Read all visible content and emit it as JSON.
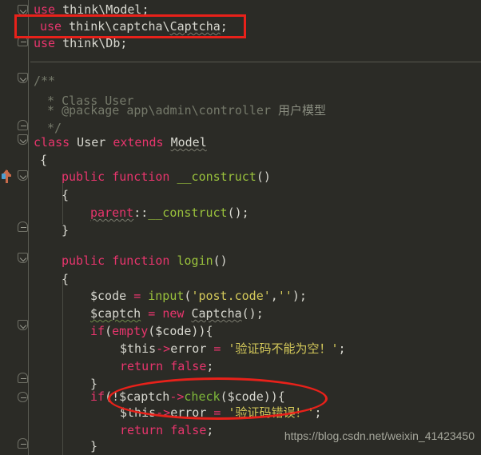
{
  "editor": {
    "language": "PHP",
    "background_color": "#2b2b26",
    "foreground_color": "#d8d8d0",
    "keyword_color": "#e8356d",
    "function_color": "#9ac23c",
    "string_color": "#d4c95a",
    "comment_color": "#767a6b",
    "annotation_color": "#e8211a"
  },
  "lines": [
    {
      "id": "l1",
      "indent": 0,
      "tokens": [
        {
          "t": "use",
          "c": "kw"
        },
        {
          "t": " think\\Model;",
          "c": "id"
        }
      ]
    },
    {
      "id": "l2",
      "indent": 0,
      "tokens": [
        {
          "t": "use",
          "c": "kw"
        },
        {
          "t": " think\\captcha\\Captcha;",
          "c": "id"
        }
      ]
    },
    {
      "id": "l3",
      "indent": 0,
      "tokens": [
        {
          "t": "use",
          "c": "kw"
        },
        {
          "t": " think\\Db;",
          "c": "id"
        }
      ]
    },
    {
      "id": "l4",
      "indent": 0,
      "tokens": [
        {
          "t": "/**",
          "c": "cmt"
        }
      ]
    },
    {
      "id": "l5",
      "indent": 0,
      "tokens": [
        {
          "t": " * Class User",
          "c": "cmt"
        }
      ]
    },
    {
      "id": "l6",
      "indent": 0,
      "tokens": [
        {
          "t": " * @package app\\admin\\controller 用户模型",
          "c": "cmt"
        }
      ]
    },
    {
      "id": "l7",
      "indent": 0,
      "tokens": [
        {
          "t": " */",
          "c": "cmt"
        }
      ]
    },
    {
      "id": "l8",
      "indent": 0,
      "tokens": [
        {
          "t": "class",
          "c": "kw"
        },
        {
          "t": " User ",
          "c": "id"
        },
        {
          "t": "extends",
          "c": "kw"
        },
        {
          "t": " Model",
          "c": "id"
        }
      ]
    },
    {
      "id": "l9",
      "indent": 0,
      "tokens": [
        {
          "t": "{",
          "c": "punc"
        }
      ]
    },
    {
      "id": "l10",
      "indent": 1,
      "tokens": [
        {
          "t": "public function",
          "c": "kw"
        },
        {
          "t": " ",
          "c": "id"
        },
        {
          "t": "__construct",
          "c": "fn"
        },
        {
          "t": "()",
          "c": "punc"
        }
      ]
    },
    {
      "id": "l11",
      "indent": 1,
      "tokens": [
        {
          "t": "{",
          "c": "punc"
        }
      ]
    },
    {
      "id": "l12",
      "indent": 2,
      "tokens": [
        {
          "t": "parent",
          "c": "kw"
        },
        {
          "t": "::",
          "c": "punc"
        },
        {
          "t": "__construct",
          "c": "fn"
        },
        {
          "t": "();",
          "c": "punc"
        }
      ]
    },
    {
      "id": "l13",
      "indent": 1,
      "tokens": [
        {
          "t": "}",
          "c": "punc"
        }
      ]
    },
    {
      "id": "l14",
      "indent": 0,
      "tokens": []
    },
    {
      "id": "l15",
      "indent": 1,
      "tokens": [
        {
          "t": "public function",
          "c": "kw"
        },
        {
          "t": " ",
          "c": "id"
        },
        {
          "t": "login",
          "c": "fn"
        },
        {
          "t": "()",
          "c": "punc"
        }
      ]
    },
    {
      "id": "l16",
      "indent": 1,
      "tokens": [
        {
          "t": "{",
          "c": "punc"
        }
      ]
    },
    {
      "id": "l17",
      "indent": 2,
      "tokens": [
        {
          "t": "$code ",
          "c": "id"
        },
        {
          "t": "=",
          "c": "kw"
        },
        {
          "t": " ",
          "c": "id"
        },
        {
          "t": "input",
          "c": "fn"
        },
        {
          "t": "(",
          "c": "punc"
        },
        {
          "t": "'post.code'",
          "c": "str"
        },
        {
          "t": ",",
          "c": "punc"
        },
        {
          "t": "''",
          "c": "str"
        },
        {
          "t": ");",
          "c": "punc"
        }
      ]
    },
    {
      "id": "l18",
      "indent": 2,
      "tokens": [
        {
          "t": "$captch ",
          "c": "id"
        },
        {
          "t": "=",
          "c": "kw"
        },
        {
          "t": " ",
          "c": "id"
        },
        {
          "t": "new",
          "c": "kw"
        },
        {
          "t": " Captcha();",
          "c": "id"
        }
      ]
    },
    {
      "id": "l19",
      "indent": 2,
      "tokens": [
        {
          "t": "if",
          "c": "kw"
        },
        {
          "t": "(",
          "c": "punc"
        },
        {
          "t": "empty",
          "c": "kw"
        },
        {
          "t": "($code)){",
          "c": "punc"
        }
      ]
    },
    {
      "id": "l20",
      "indent": 3,
      "tokens": [
        {
          "t": "$this",
          "c": "id"
        },
        {
          "t": "->",
          "c": "kw"
        },
        {
          "t": "error ",
          "c": "id"
        },
        {
          "t": "=",
          "c": "kw"
        },
        {
          "t": " ",
          "c": "id"
        },
        {
          "t": "'验证码不能为空！'",
          "c": "str"
        },
        {
          "t": ";",
          "c": "punc"
        }
      ]
    },
    {
      "id": "l21",
      "indent": 3,
      "tokens": [
        {
          "t": "return false",
          "c": "kw"
        },
        {
          "t": ";",
          "c": "punc"
        }
      ]
    },
    {
      "id": "l22",
      "indent": 2,
      "tokens": [
        {
          "t": "}",
          "c": "punc"
        }
      ]
    },
    {
      "id": "l23",
      "indent": 2,
      "tokens": [
        {
          "t": "if",
          "c": "kw"
        },
        {
          "t": "(!",
          "c": "punc"
        },
        {
          "t": "$captch",
          "c": "id"
        },
        {
          "t": "->",
          "c": "kw"
        },
        {
          "t": "check",
          "c": "meth"
        },
        {
          "t": "($code)){",
          "c": "punc"
        }
      ]
    },
    {
      "id": "l24",
      "indent": 3,
      "tokens": [
        {
          "t": "$this",
          "c": "id"
        },
        {
          "t": "->",
          "c": "kw"
        },
        {
          "t": "error ",
          "c": "id"
        },
        {
          "t": "=",
          "c": "kw"
        },
        {
          "t": " ",
          "c": "id"
        },
        {
          "t": "'验证码错误！'",
          "c": "str"
        },
        {
          "t": ";",
          "c": "punc"
        }
      ]
    },
    {
      "id": "l25",
      "indent": 3,
      "tokens": [
        {
          "t": "return false",
          "c": "kw"
        },
        {
          "t": ";",
          "c": "punc"
        }
      ]
    },
    {
      "id": "l26",
      "indent": 2,
      "tokens": [
        {
          "t": "}",
          "c": "punc"
        }
      ]
    }
  ],
  "annotations": {
    "rect_label": "highlight-use-captcha-import",
    "ellipse_label": "highlight-captcha-check-condition"
  },
  "watermark": {
    "text": "https://blog.csdn.net/weixin_41423450"
  }
}
